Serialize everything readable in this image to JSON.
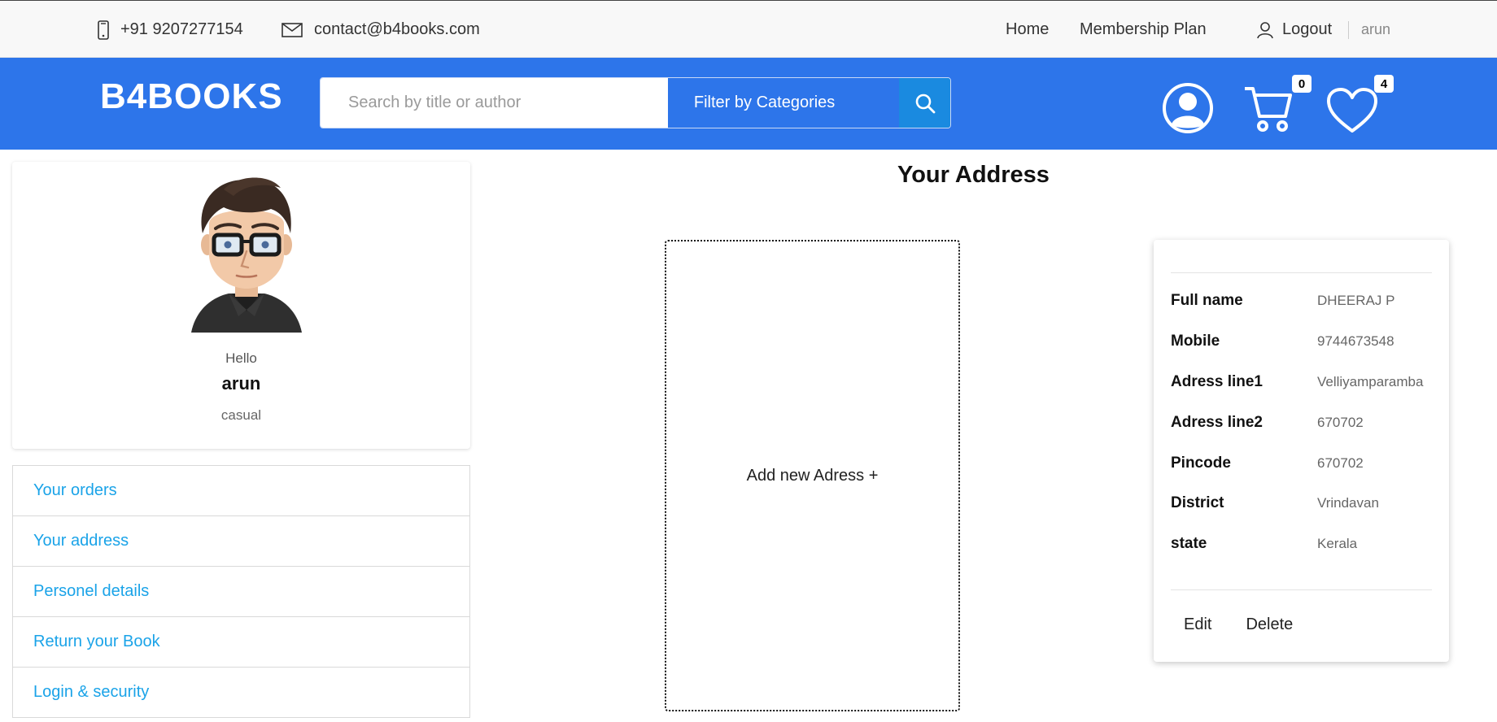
{
  "topbar": {
    "phone": "+91 9207277154",
    "email": "contact@b4books.com",
    "nav": {
      "home": "Home",
      "membership": "Membership Plan",
      "logout": "Logout",
      "user": "arun"
    }
  },
  "header": {
    "logo": "B4BOOKS",
    "search_placeholder": "Search by title or author",
    "filter_label": "Filter by Categories",
    "cart_count": "0",
    "wishlist_count": "4"
  },
  "profile": {
    "greeting": "Hello",
    "name": "arun",
    "type": "casual"
  },
  "side_menu": [
    {
      "label": "Your orders"
    },
    {
      "label": "Your address"
    },
    {
      "label": "Personel details"
    },
    {
      "label": "Return your Book"
    },
    {
      "label": "Login & security"
    }
  ],
  "main": {
    "title": "Your Address",
    "add_new": "Add new Adress +",
    "address": [
      {
        "label": "Full name",
        "value": "DHEERAJ P"
      },
      {
        "label": "Mobile",
        "value": "9744673548"
      },
      {
        "label": "Adress line1",
        "value": "Velliyamparamba"
      },
      {
        "label": "Adress line2",
        "value": "670702"
      },
      {
        "label": "Pincode",
        "value": "670702"
      },
      {
        "label": "District",
        "value": "Vrindavan"
      },
      {
        "label": "state",
        "value": "Kerala"
      }
    ],
    "actions": {
      "edit": "Edit",
      "delete": "Delete"
    }
  },
  "colors": {
    "brand_blue": "#2d75ea",
    "link": "#1aa3e8",
    "search_btn": "#1a8ae0"
  }
}
